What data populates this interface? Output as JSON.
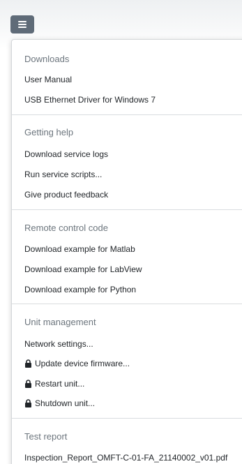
{
  "menu_button": {
    "icon": "hamburger-icon"
  },
  "sections": {
    "downloads": {
      "header": "Downloads",
      "items": [
        "User Manual",
        "USB Ethernet Driver for Windows 7"
      ]
    },
    "getting_help": {
      "header": "Getting help",
      "items": [
        "Download service logs",
        "Run service scripts...",
        "Give product feedback"
      ]
    },
    "remote_control": {
      "header": "Remote control code",
      "items": [
        "Download example for Matlab",
        "Download example for LabView",
        "Download example for Python"
      ]
    },
    "unit_management": {
      "header": "Unit management",
      "items": [
        "Network settings...",
        "Update device firmware...",
        "Restart unit...",
        "Shutdown unit..."
      ],
      "locked_item_icon": "lock-icon"
    },
    "test_report": {
      "header": "Test report",
      "items": [
        "Inspection_Report_OMFT-C-01-FA_21140002_v01.pdf"
      ]
    }
  },
  "colors": {
    "button_bg": "#5f6b78",
    "header_text": "#6c757d",
    "item_text": "#212529",
    "divider": "#d9dcdf"
  }
}
